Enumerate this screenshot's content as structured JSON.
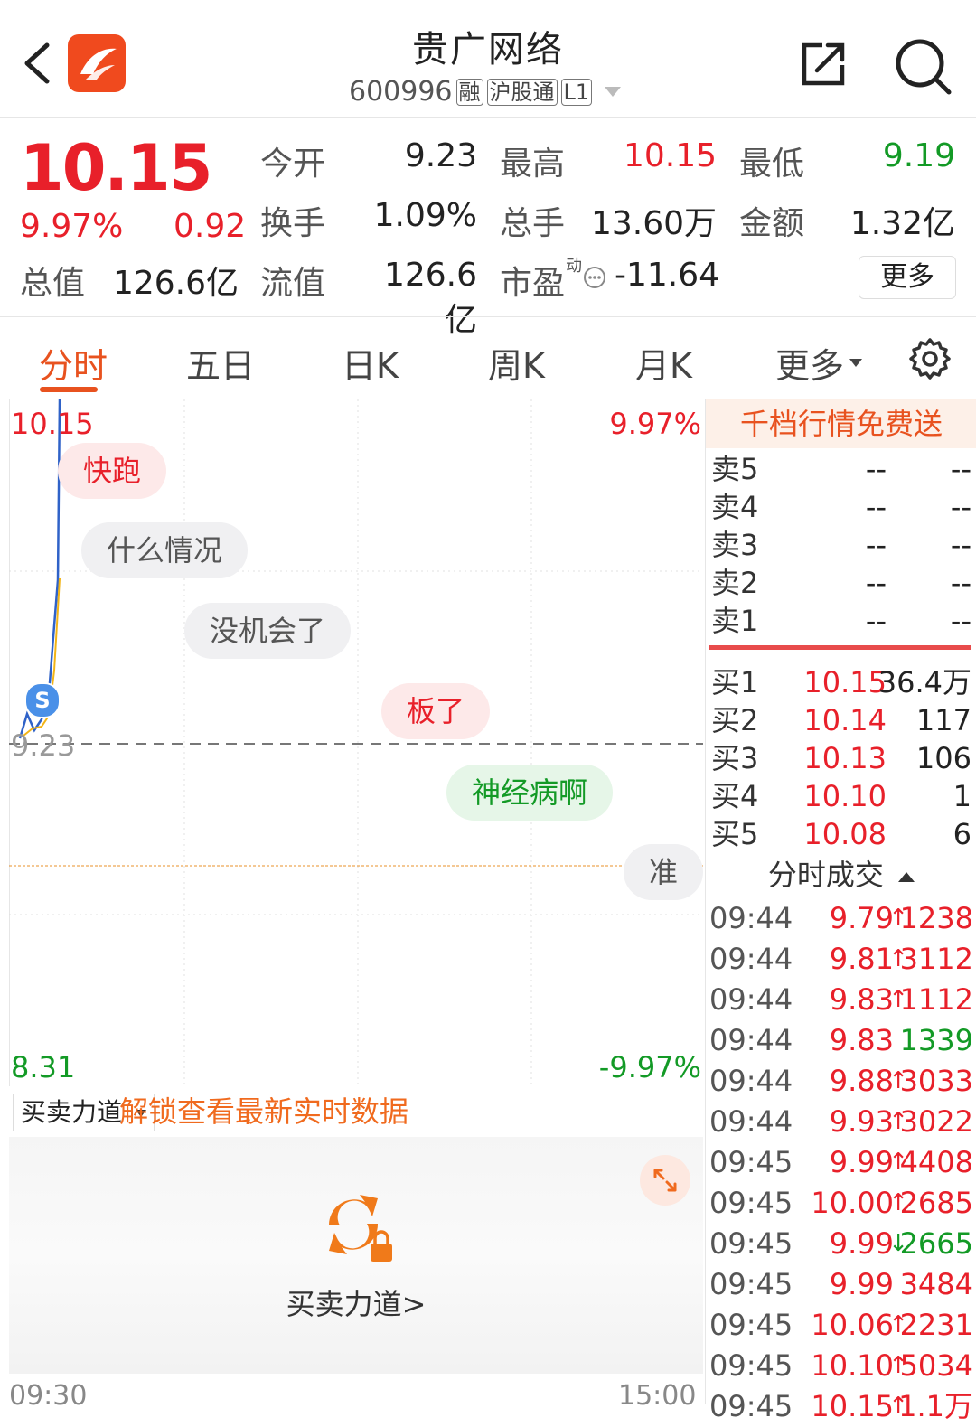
{
  "header": {
    "title": "贵广网络",
    "code": "600996",
    "tags": [
      "融",
      "沪股通",
      "L1"
    ]
  },
  "quote": {
    "price": "10.15",
    "change_pct": "9.97%",
    "change": "0.92",
    "stats": [
      {
        "label": "今开",
        "value": "9.23",
        "color": "neutral"
      },
      {
        "label": "最高",
        "value": "10.15",
        "color": "red"
      },
      {
        "label": "最低",
        "value": "9.19",
        "color": "green"
      },
      {
        "label": "换手",
        "value": "1.09%",
        "color": "neutral"
      },
      {
        "label": "总手",
        "value": "13.60万",
        "color": "neutral"
      },
      {
        "label": "金额",
        "value": "1.32亿",
        "color": "neutral"
      },
      {
        "label": "总值",
        "value": "126.6亿",
        "color": "neutral"
      },
      {
        "label": "流值",
        "value": "126.6亿",
        "color": "neutral"
      },
      {
        "label": "市盈",
        "value": "-11.64",
        "color": "neutral",
        "superscript": "动"
      }
    ],
    "more_label": "更多"
  },
  "tabs": [
    "分时",
    "五日",
    "日K",
    "周K",
    "月K",
    "更多"
  ],
  "chart": {
    "top_price": "10.15",
    "top_pct": "9.97%",
    "ref_price": "9.23",
    "bottom_price": "8.31",
    "bottom_pct": "-9.97%",
    "start_time": "09:30",
    "end_time": "15:00",
    "danmaku": [
      {
        "text": "快跑",
        "style": "red"
      },
      {
        "text": "什么情况",
        "style": "gray"
      },
      {
        "text": "没机会了",
        "style": "gray"
      },
      {
        "text": "板了",
        "style": "red"
      },
      {
        "text": "神经病啊",
        "style": "green"
      },
      {
        "text": "准备",
        "style": "gray"
      }
    ],
    "marker_letter": "S"
  },
  "buy_sell": {
    "select_label": "买卖力道",
    "unlock_text": "解锁查看最新实时数据",
    "panel_label": "买卖力道>"
  },
  "orderbook": {
    "promo": "千档行情免费送",
    "sells": [
      {
        "name": "卖5",
        "price": "--",
        "vol": "--"
      },
      {
        "name": "卖4",
        "price": "--",
        "vol": "--"
      },
      {
        "name": "卖3",
        "price": "--",
        "vol": "--"
      },
      {
        "name": "卖2",
        "price": "--",
        "vol": "--"
      },
      {
        "name": "卖1",
        "price": "--",
        "vol": "--"
      }
    ],
    "buys": [
      {
        "name": "买1",
        "price": "10.15",
        "vol": "36.4万"
      },
      {
        "name": "买2",
        "price": "10.14",
        "vol": "117"
      },
      {
        "name": "买3",
        "price": "10.13",
        "vol": "106"
      },
      {
        "name": "买4",
        "price": "10.10",
        "vol": "1"
      },
      {
        "name": "买5",
        "price": "10.08",
        "vol": "6"
      }
    ]
  },
  "trades": {
    "title": "分时成交",
    "rows": [
      {
        "time": "09:44",
        "price": "9.79",
        "dir": "↑",
        "vol": "1238",
        "vol_color": "red"
      },
      {
        "time": "09:44",
        "price": "9.81",
        "dir": "↑",
        "vol": "3112",
        "vol_color": "red"
      },
      {
        "time": "09:44",
        "price": "9.83",
        "dir": "↑",
        "vol": "1112",
        "vol_color": "red"
      },
      {
        "time": "09:44",
        "price": "9.83",
        "dir": "",
        "vol": "1339",
        "vol_color": "green"
      },
      {
        "time": "09:44",
        "price": "9.88",
        "dir": "↑",
        "vol": "3033",
        "vol_color": "red"
      },
      {
        "time": "09:44",
        "price": "9.93",
        "dir": "↑",
        "vol": "3022",
        "vol_color": "red"
      },
      {
        "time": "09:45",
        "price": "9.99",
        "dir": "↑",
        "vol": "4408",
        "vol_color": "red"
      },
      {
        "time": "09:45",
        "price": "10.00",
        "dir": "↑",
        "vol": "2685",
        "vol_color": "red"
      },
      {
        "time": "09:45",
        "price": "9.99",
        "dir": "↓",
        "vol": "2665",
        "vol_color": "green"
      },
      {
        "time": "09:45",
        "price": "9.99",
        "dir": "",
        "vol": "3484",
        "vol_color": "red"
      },
      {
        "time": "09:45",
        "price": "10.06",
        "dir": "↑",
        "vol": "2231",
        "vol_color": "red"
      },
      {
        "time": "09:45",
        "price": "10.10",
        "dir": "↑",
        "vol": "5034",
        "vol_color": "red"
      },
      {
        "time": "09:45",
        "price": "10.15",
        "dir": "↑",
        "vol": "1.1万",
        "vol_color": "red"
      }
    ]
  },
  "colors": {
    "up": "#e8202a",
    "down": "#139a26",
    "accent": "#e8521f"
  }
}
